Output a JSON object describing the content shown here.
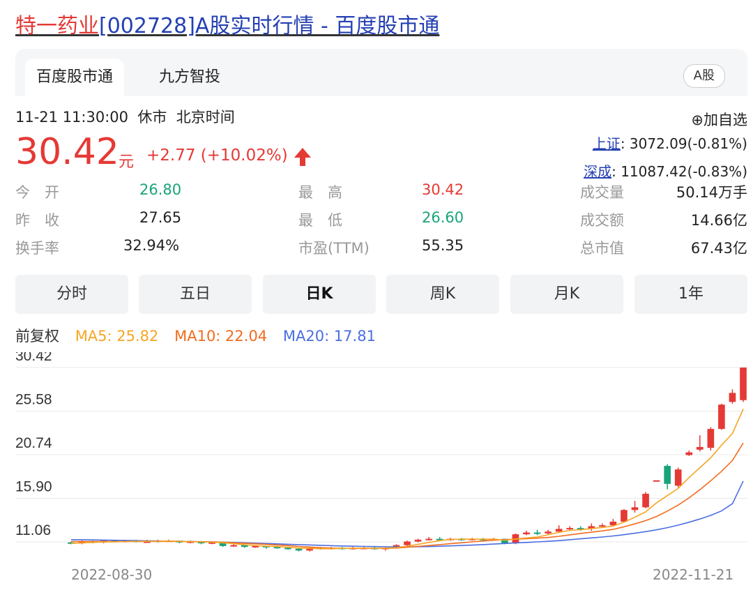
{
  "page": {
    "title_stock": "特一药业",
    "title_rest": "[002728]A股实时行情 - 百度股市通"
  },
  "tabs": [
    {
      "label": "百度股市通",
      "active": true
    },
    {
      "label": "九方智投",
      "active": false
    }
  ],
  "market_badge": "A股",
  "quote": {
    "time": "11-21 11:30:00",
    "status": "休市",
    "timezone": "北京时间",
    "price": "30.42",
    "unit": "元",
    "change": "+2.77 (+10.02%)",
    "add_watch": "⊕加自选",
    "index1_name": "上证",
    "index1_value": ": 3072.09(-0.81%)",
    "index2_name": "深成",
    "index2_value": ": 11087.42(-0.83%)"
  },
  "stats": {
    "open_label": "今　开",
    "open": "26.80",
    "prev_label": "昨　收",
    "prev": "27.65",
    "turnover_label": "换手率",
    "turnover": "32.94%",
    "high_label": "最　高",
    "high": "30.42",
    "low_label": "最　低",
    "low": "26.60",
    "pe_label": "市盈(TTM)",
    "pe": "55.35",
    "volume_label": "成交量",
    "volume": "50.14万手",
    "amount_label": "成交额",
    "amount": "14.66亿",
    "mktcap_label": "总市值",
    "mktcap": "67.43亿"
  },
  "periods": [
    {
      "label": "分时",
      "active": false
    },
    {
      "label": "五日",
      "active": false
    },
    {
      "label": "日K",
      "active": true
    },
    {
      "label": "周K",
      "active": false
    },
    {
      "label": "月K",
      "active": false
    },
    {
      "label": "1年",
      "active": false
    }
  ],
  "ma_legend": {
    "adjust": "前复权",
    "ma5": "MA5: 25.82",
    "ma10": "MA10: 22.04",
    "ma20": "MA20: 17.81"
  },
  "colors": {
    "up": "#e53935",
    "down": "#1aa37a",
    "ma5": "#f5a623",
    "ma10": "#f26b1d",
    "ma20": "#4a6ee0",
    "link": "#2440b3"
  },
  "chart_data": {
    "type": "candlestick",
    "y_ticks": [
      "30.42",
      "25.58",
      "20.74",
      "15.90",
      "11.06"
    ],
    "ylim": [
      11.06,
      30.42
    ],
    "x_start_label": "2022-08-30",
    "x_end_label": "2022-11-21",
    "grid": true,
    "candles": [
      [
        11.0,
        10.9,
        11.1,
        10.8
      ],
      [
        10.9,
        11.1,
        11.2,
        10.8
      ],
      [
        11.1,
        11.0,
        11.2,
        10.9
      ],
      [
        11.0,
        11.2,
        11.3,
        10.9
      ],
      [
        11.2,
        11.1,
        11.3,
        11.0
      ],
      [
        11.1,
        11.2,
        11.3,
        11.0
      ],
      [
        11.2,
        11.1,
        11.3,
        11.0
      ],
      [
        11.1,
        11.1,
        11.3,
        11.0
      ],
      [
        11.1,
        11.2,
        11.3,
        11.0
      ],
      [
        11.2,
        11.2,
        11.3,
        11.1
      ],
      [
        11.2,
        11.0,
        11.2,
        10.9
      ],
      [
        11.0,
        11.1,
        11.2,
        10.9
      ],
      [
        11.1,
        10.9,
        11.1,
        10.8
      ],
      [
        10.9,
        11.0,
        11.1,
        10.8
      ],
      [
        11.0,
        10.6,
        11.0,
        10.5
      ],
      [
        10.6,
        10.7,
        10.8,
        10.5
      ],
      [
        10.7,
        10.5,
        10.7,
        10.4
      ],
      [
        10.5,
        10.6,
        10.7,
        10.4
      ],
      [
        10.6,
        10.5,
        10.6,
        10.3
      ],
      [
        10.5,
        10.4,
        10.6,
        10.3
      ],
      [
        10.4,
        10.3,
        10.5,
        10.2
      ],
      [
        10.3,
        10.1,
        10.4,
        10.0
      ],
      [
        10.1,
        10.4,
        10.5,
        10.0
      ],
      [
        10.4,
        10.3,
        10.5,
        10.2
      ],
      [
        10.3,
        10.4,
        10.5,
        10.2
      ],
      [
        10.4,
        10.3,
        10.5,
        10.2
      ],
      [
        10.3,
        10.4,
        10.5,
        10.2
      ],
      [
        10.4,
        10.4,
        10.5,
        10.3
      ],
      [
        10.4,
        10.3,
        10.5,
        10.2
      ],
      [
        10.3,
        10.4,
        10.5,
        10.1
      ],
      [
        10.4,
        10.7,
        10.8,
        10.3
      ],
      [
        10.7,
        11.1,
        11.2,
        10.6
      ],
      [
        11.1,
        11.3,
        11.4,
        11.0
      ],
      [
        11.3,
        11.4,
        11.6,
        11.2
      ],
      [
        11.4,
        11.3,
        11.6,
        11.2
      ],
      [
        11.3,
        11.4,
        11.5,
        11.2
      ],
      [
        11.4,
        11.3,
        11.5,
        11.2
      ],
      [
        11.3,
        11.4,
        11.5,
        11.2
      ],
      [
        11.4,
        11.3,
        11.5,
        11.2
      ],
      [
        11.3,
        11.4,
        11.5,
        11.2
      ],
      [
        11.4,
        10.9,
        11.4,
        10.8
      ],
      [
        10.9,
        11.9,
        12.0,
        10.8
      ],
      [
        11.9,
        12.1,
        12.3,
        11.8
      ],
      [
        12.1,
        12.0,
        12.4,
        11.8
      ],
      [
        12.0,
        12.2,
        12.4,
        11.9
      ],
      [
        12.2,
        12.5,
        12.9,
        12.1
      ],
      [
        12.5,
        12.6,
        12.8,
        12.3
      ],
      [
        12.6,
        12.5,
        12.8,
        12.3
      ],
      [
        12.5,
        12.8,
        13.1,
        12.3
      ],
      [
        12.8,
        12.9,
        13.1,
        12.6
      ],
      [
        12.9,
        13.3,
        13.6,
        12.8
      ],
      [
        13.3,
        14.6,
        14.7,
        13.2
      ],
      [
        14.6,
        14.9,
        15.6,
        14.3
      ],
      [
        14.9,
        16.4,
        16.6,
        14.8
      ],
      [
        17.9,
        17.9,
        17.9,
        17.9
      ],
      [
        19.5,
        17.5,
        19.7,
        16.9
      ],
      [
        17.3,
        19.1,
        19.3,
        17.1
      ],
      [
        20.7,
        21.0,
        21.2,
        20.6
      ],
      [
        21.3,
        21.6,
        22.9,
        21.1
      ],
      [
        21.5,
        23.6,
        23.8,
        21.2
      ],
      [
        23.6,
        26.3,
        26.4,
        23.5
      ],
      [
        26.6,
        27.6,
        28.0,
        26.4
      ],
      [
        26.8,
        30.42,
        30.42,
        26.6
      ]
    ],
    "ma5": [
      10.9,
      10.95,
      11.0,
      11.05,
      11.05,
      11.1,
      11.12,
      11.12,
      11.14,
      11.16,
      11.12,
      11.08,
      11.06,
      11.02,
      10.96,
      10.86,
      10.74,
      10.66,
      10.58,
      10.54,
      10.46,
      10.38,
      10.34,
      10.3,
      10.3,
      10.34,
      10.36,
      10.36,
      10.36,
      10.36,
      10.42,
      10.58,
      10.78,
      11.0,
      11.2,
      11.34,
      11.36,
      11.36,
      11.36,
      11.36,
      11.24,
      11.38,
      11.5,
      11.6,
      11.84,
      12.12,
      12.34,
      12.42,
      12.54,
      12.66,
      12.82,
      13.24,
      13.8,
      14.4,
      15.4,
      16.2,
      17.0,
      18.2,
      19.3,
      20.4,
      21.8,
      23.1,
      25.82
    ],
    "ma10": [
      11.1,
      11.1,
      11.1,
      11.1,
      11.1,
      11.1,
      11.1,
      11.1,
      11.12,
      11.12,
      11.1,
      11.09,
      11.07,
      11.05,
      11.02,
      10.96,
      10.9,
      10.85,
      10.78,
      10.72,
      10.65,
      10.56,
      10.49,
      10.42,
      10.37,
      10.35,
      10.34,
      10.34,
      10.34,
      10.34,
      10.38,
      10.46,
      10.56,
      10.66,
      10.76,
      10.86,
      10.96,
      11.06,
      11.16,
      11.26,
      11.3,
      11.36,
      11.42,
      11.48,
      11.55,
      11.68,
      11.84,
      12.0,
      12.14,
      12.28,
      12.45,
      12.73,
      13.06,
      13.42,
      13.88,
      14.48,
      15.15,
      15.95,
      16.85,
      17.85,
      18.9,
      20.1,
      22.04
    ],
    "ma20": [
      11.3,
      11.3,
      11.28,
      11.26,
      11.24,
      11.22,
      11.2,
      11.18,
      11.16,
      11.14,
      11.12,
      11.1,
      11.08,
      11.06,
      11.03,
      11.0,
      10.96,
      10.92,
      10.88,
      10.84,
      10.8,
      10.76,
      10.72,
      10.68,
      10.64,
      10.6,
      10.58,
      10.56,
      10.54,
      10.52,
      10.5,
      10.5,
      10.52,
      10.54,
      10.58,
      10.62,
      10.66,
      10.7,
      10.76,
      10.82,
      10.88,
      10.94,
      11.0,
      11.06,
      11.12,
      11.2,
      11.3,
      11.4,
      11.5,
      11.6,
      11.72,
      11.86,
      12.02,
      12.2,
      12.4,
      12.64,
      12.92,
      13.24,
      13.6,
      14.0,
      14.5,
      15.3,
      17.81
    ]
  }
}
